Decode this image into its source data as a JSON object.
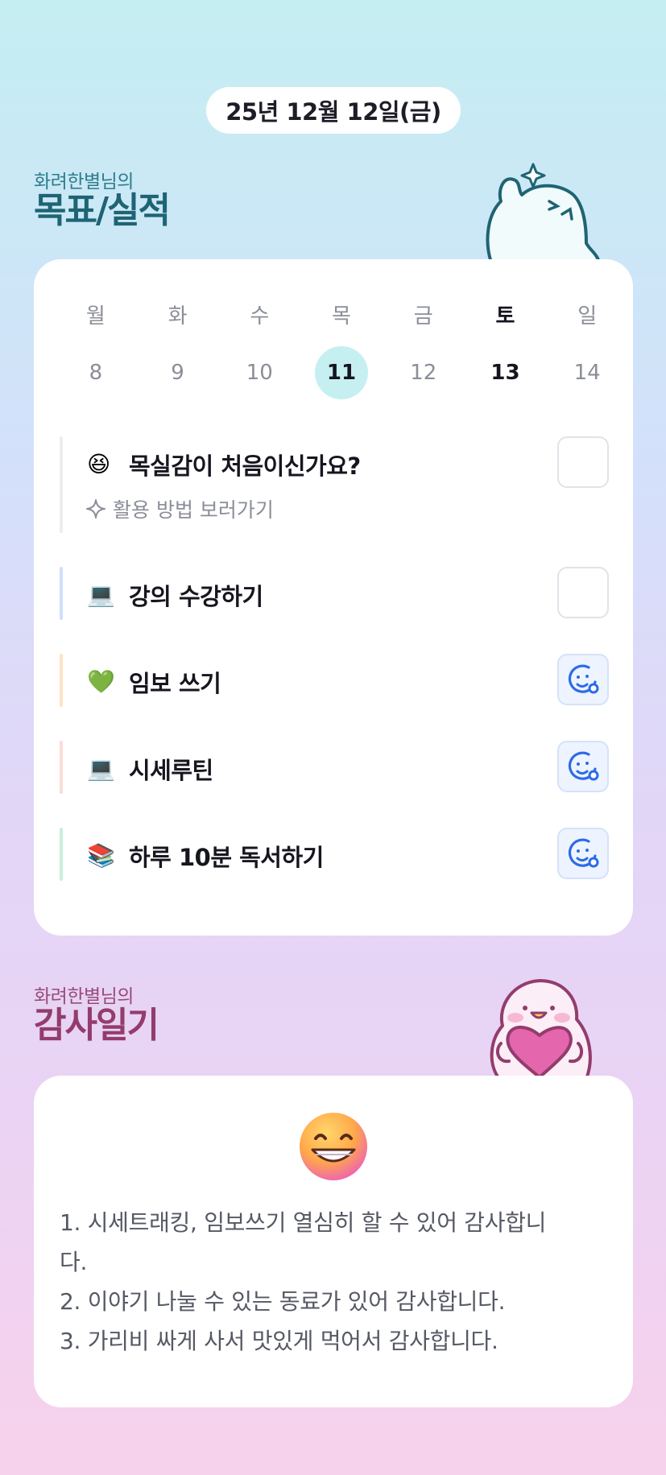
{
  "header": {
    "date": "25년 12월 12일(금)"
  },
  "goals_section": {
    "subtitle": "화려한별님의",
    "title": "목표/실적"
  },
  "calendar": {
    "weekdays": [
      "월",
      "화",
      "수",
      "목",
      "금",
      "토",
      "일"
    ],
    "dates": [
      "8",
      "9",
      "10",
      "11",
      "12",
      "13",
      "14"
    ],
    "selected": "11",
    "highlight_day": "토"
  },
  "goals": [
    {
      "emoji": "😆",
      "title": "목실감이 처음이신가요?",
      "link": "활용 방법 보러가기",
      "done": false,
      "color": "#ededed"
    },
    {
      "emoji": "💻",
      "title": "강의 수강하기",
      "done": false,
      "color": "#cfe0fb"
    },
    {
      "emoji": "💚",
      "title": "임보 쓰기",
      "done": true,
      "color": "#fde3c6"
    },
    {
      "emoji": "💻",
      "title": "시세루틴",
      "done": true,
      "color": "#fbdcd8"
    },
    {
      "emoji": "📚",
      "title": "하루 10분 독서하기",
      "done": true,
      "color": "#c9efdc"
    }
  ],
  "thanks_section": {
    "subtitle": "화려한별님의",
    "title": "감사일기"
  },
  "diary": {
    "mood_icon": "grinning-face",
    "lines": [
      "1. 시세트래킹, 임보쓰기 열심히 할 수 있어 감사합니\n다.",
      "2. 이야기 나눌 수 있는 동료가 있어 감사합니다.",
      "3. 가리비 싸게 사서 맛있게 먹어서 감사합니다."
    ]
  },
  "colors": {
    "accent": "#2b6be8",
    "selected_date_bg": "#c6eff1",
    "goal_title": "#1e6474",
    "thanks_title": "#933c6d"
  }
}
